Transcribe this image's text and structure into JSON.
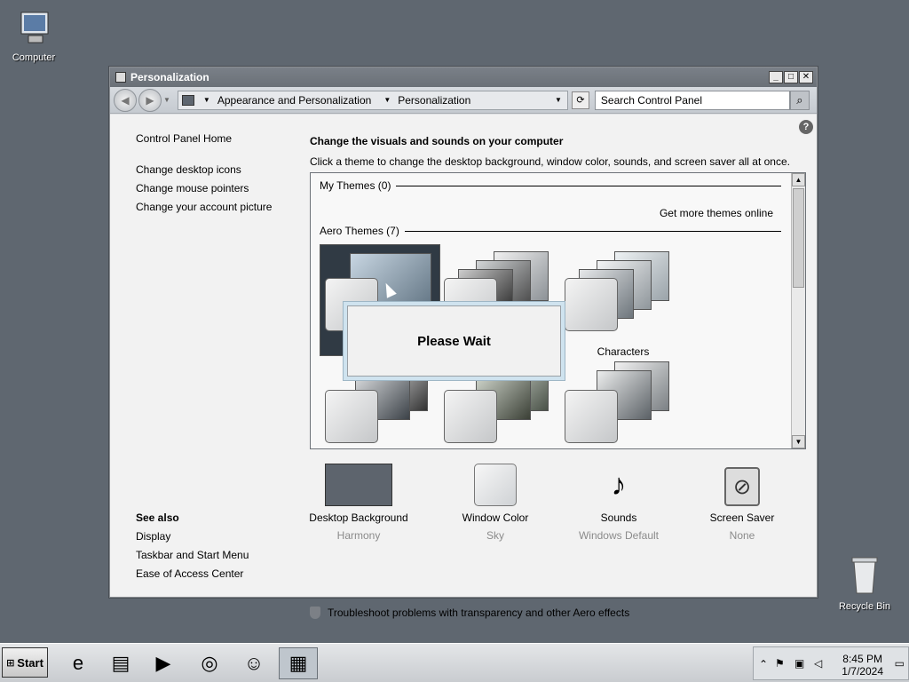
{
  "desktop": {
    "computer_label": "Computer",
    "recycle_label": "Recycle Bin"
  },
  "window": {
    "title": "Personalization",
    "buttons": {
      "minimize": "_",
      "maximize": "□",
      "close": "✕"
    },
    "breadcrumbs": [
      "Appearance and Personalization",
      "Personalization"
    ],
    "search_placeholder": "Search Control Panel"
  },
  "left_pane": {
    "home": "Control Panel Home",
    "links": [
      "Change desktop icons",
      "Change mouse pointers",
      "Change your account picture"
    ],
    "see_also_title": "See also",
    "see_also": [
      "Display",
      "Taskbar and Start Menu",
      "Ease of Access Center"
    ]
  },
  "main": {
    "heading": "Change the visuals and sounds on your computer",
    "subtext": "Click a theme to change the desktop background, window color, sounds, and screen saver all at once.",
    "my_themes": "My Themes (0)",
    "get_more": "Get more themes online",
    "aero_themes": "Aero Themes (7)",
    "theme_names": [
      "Characters"
    ],
    "dialog": "Please Wait",
    "tiles": [
      {
        "label": "Desktop Background",
        "sub": "Harmony"
      },
      {
        "label": "Window Color",
        "sub": "Sky"
      },
      {
        "label": "Sounds",
        "sub": "Windows Default"
      },
      {
        "label": "Screen Saver",
        "sub": "None"
      }
    ],
    "troubleshoot": "Troubleshoot problems with transparency and other Aero effects"
  },
  "taskbar": {
    "start": "Start",
    "time": "8:45 PM",
    "date": "1/7/2024"
  },
  "icons": {
    "help": "?",
    "sounds": "♪",
    "screen_saver": "⃠"
  },
  "colors": {
    "desktop": "#5f6770",
    "accent": "#cfe3ef"
  }
}
